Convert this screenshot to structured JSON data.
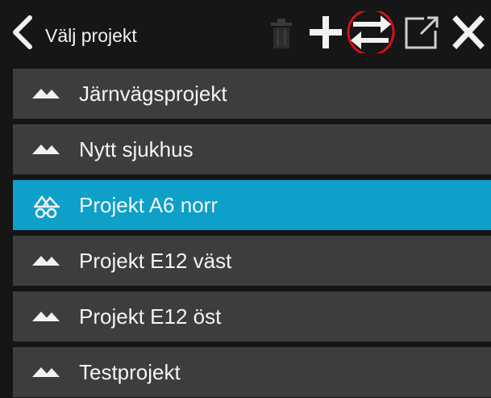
{
  "header": {
    "title": "Välj projekt",
    "icons": [
      "chevron-left-icon",
      "trash-icon",
      "plus-icon",
      "switch-arrows-icon",
      "open-external-icon",
      "close-icon"
    ],
    "highlight_color": "#d0121a"
  },
  "projects": [
    {
      "name": "Järnvägsprojekt",
      "icon": "mountain-icon",
      "selected": false
    },
    {
      "name": "Nytt sjukhus",
      "icon": "mountain-icon",
      "selected": false
    },
    {
      "name": "Projekt A6 norr",
      "icon": "surveyor-icon",
      "selected": true
    },
    {
      "name": "Projekt E12 väst",
      "icon": "mountain-icon",
      "selected": false
    },
    {
      "name": "Projekt E12 öst",
      "icon": "mountain-icon",
      "selected": false
    },
    {
      "name": "Testprojekt",
      "icon": "mountain-icon",
      "selected": false
    }
  ],
  "colors": {
    "background": "#151515",
    "row": "#3d3d3d",
    "selected_row": "#0ea0c8",
    "text": "#f4f4f4"
  }
}
